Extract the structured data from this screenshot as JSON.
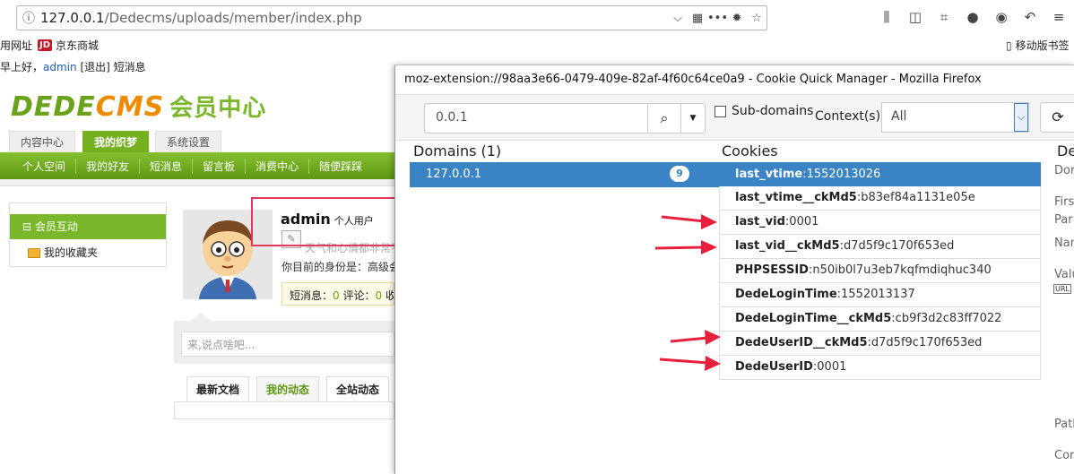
{
  "browser": {
    "url_host": "127.0.0.1",
    "url_path": "/Dedecms/uploads/member/index.php",
    "bookmarks": [
      {
        "label": "用网址"
      },
      {
        "label": "京东商城",
        "badge": "JD"
      },
      {
        "label": "移动版书签"
      }
    ]
  },
  "dede": {
    "greeting": "早上好，",
    "user": "admin",
    "logout": "[退出]",
    "messages": "短消息",
    "logo_part1": "DEDE",
    "logo_part2": "CMS",
    "logo_cn": "会员中心",
    "top_tabs": [
      "内容中心",
      "我的织梦",
      "系统设置"
    ],
    "nav": [
      "个人空间",
      "我的好友",
      "短消息",
      "留言板",
      "消费中心",
      "随便踩踩"
    ],
    "side_head": "会员互动",
    "side_item": "我的收藏夹",
    "profile_name": "admin",
    "profile_type": "个人用户",
    "mood": "天气和心情都非常不",
    "identity": "你目前的身份是：高级会",
    "stats": {
      "msg_label": "短消息：",
      "msg": "0",
      "comment_label": "评论：",
      "comment": "0",
      "fav_label": "收藏"
    },
    "say_placeholder": "来,说点啥吧...",
    "feed_tabs": [
      "最新文档",
      "我的动态",
      "全站动态"
    ]
  },
  "cqm": {
    "title": "moz-extension://98aa3e66-0479-409e-82af-4f60c64ce0a9 - Cookie Quick Manager - Mozilla Firefox",
    "search_value": "0.0.1",
    "subdomains_label": "Sub-domains",
    "context_label": "Context(s):",
    "context_value": "All",
    "domains_header": "Domains (1)",
    "cookies_header": "Cookies",
    "details_header": "De",
    "domain": {
      "name": "127.0.0.1",
      "count": "9"
    },
    "cookies": [
      {
        "name": "last_vtime",
        "value": ":1552013026"
      },
      {
        "name": "last_vtime__ckMd5",
        "value": ":b83ef84a1131e05e"
      },
      {
        "name": "last_vid",
        "value": ":0001"
      },
      {
        "name": "last_vid__ckMd5",
        "value": ":d7d5f9c170f653ed"
      },
      {
        "name": "PHPSESSID",
        "value": ":n50ib0l7u3eb7kqfmdiqhuc340"
      },
      {
        "name": "DedeLoginTime",
        "value": ":1552013137"
      },
      {
        "name": "DedeLoginTime__ckMd5",
        "value": ":cb9f3d2c83ff7022"
      },
      {
        "name": "DedeUserID__ckMd5",
        "value": ":d7d5f9c170f653ed"
      },
      {
        "name": "DedeUserID",
        "value": ":0001"
      }
    ],
    "details": {
      "domain": "Don",
      "first": "Firs",
      "party": "Par",
      "name": "Nam",
      "value": "Valu",
      "url_chip": "URL",
      "path": "Path",
      "cont": "Cor"
    }
  }
}
